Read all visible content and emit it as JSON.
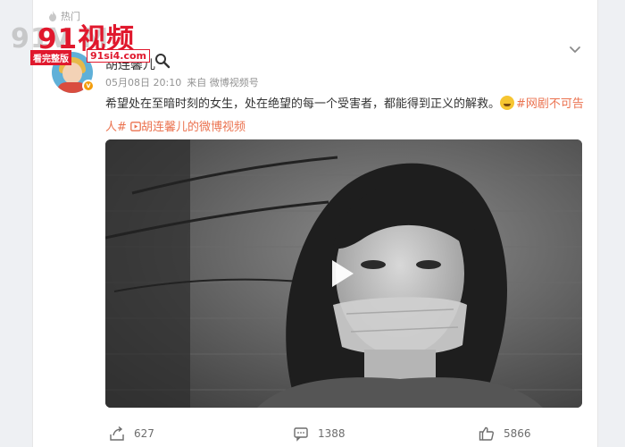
{
  "header": {
    "hot_label": "热门"
  },
  "watermark": {
    "bg_text": "91V          M",
    "main_text": "91视频",
    "tag_left": "看完整版",
    "tag_right": "91si4.com"
  },
  "post": {
    "author": "胡连馨儿",
    "date": "05月08日 20:10",
    "source": "来自 微博视频号",
    "text_main": "希望处在至暗时刻的女生，处在绝望的每一个受害者，都能得到正义的解救。",
    "hashtag": "#网剧不可告人#",
    "video_link": "胡连馨儿的微博视频"
  },
  "actions": {
    "share_count": "627",
    "comment_count": "1388",
    "like_count": "5866"
  },
  "colors": {
    "accent": "#eb7350",
    "watermark_red": "#e0182d",
    "badge": "#f39d0c"
  }
}
